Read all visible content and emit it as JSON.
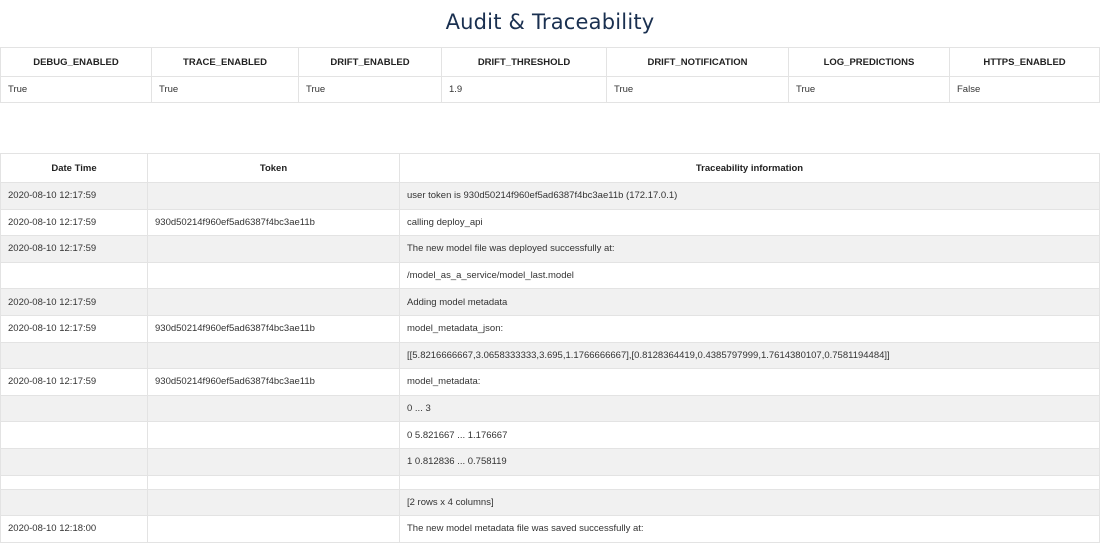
{
  "page": {
    "title": "Audit & Traceability"
  },
  "config": {
    "headers": [
      "DEBUG_ENABLED",
      "TRACE_ENABLED",
      "DRIFT_ENABLED",
      "DRIFT_THRESHOLD",
      "DRIFT_NOTIFICATION",
      "LOG_PREDICTIONS",
      "HTTPS_ENABLED"
    ],
    "values": [
      "True",
      "True",
      "True",
      "1.9",
      "True",
      "True",
      "False"
    ]
  },
  "trace": {
    "headers": [
      "Date Time",
      "Token",
      "Traceability information"
    ],
    "rows": [
      {
        "datetime": "2020-08-10 12:17:59",
        "token": "",
        "info": "user token is 930d50214f960ef5ad6387f4bc3ae11b (172.17.0.1)"
      },
      {
        "datetime": "2020-08-10 12:17:59",
        "token": "930d50214f960ef5ad6387f4bc3ae11b",
        "info": "calling deploy_api"
      },
      {
        "datetime": "2020-08-10 12:17:59",
        "token": "",
        "info": "The new model file was deployed successfully at:"
      },
      {
        "datetime": "",
        "token": "",
        "info": "/model_as_a_service/model_last.model"
      },
      {
        "datetime": "2020-08-10 12:17:59",
        "token": "",
        "info": "Adding model metadata"
      },
      {
        "datetime": "2020-08-10 12:17:59",
        "token": "930d50214f960ef5ad6387f4bc3ae11b",
        "info": "model_metadata_json:"
      },
      {
        "datetime": "",
        "token": "",
        "info": "[[5.8216666667,3.0658333333,3.695,1.1766666667],[0.8128364419,0.4385797999,1.7614380107,0.7581194484]]"
      },
      {
        "datetime": "2020-08-10 12:17:59",
        "token": "930d50214f960ef5ad6387f4bc3ae11b",
        "info": "model_metadata:"
      },
      {
        "datetime": "",
        "token": "",
        "info": "0 ... 3"
      },
      {
        "datetime": "",
        "token": "",
        "info": "0 5.821667 ... 1.176667"
      },
      {
        "datetime": "",
        "token": "",
        "info": "1 0.812836 ... 0.758119"
      },
      {
        "datetime": "",
        "token": "",
        "info": ""
      },
      {
        "datetime": "",
        "token": "",
        "info": "[2 rows x 4 columns]"
      },
      {
        "datetime": "2020-08-10 12:18:00",
        "token": "",
        "info": "The new model metadata file was saved successfully at:"
      }
    ]
  }
}
